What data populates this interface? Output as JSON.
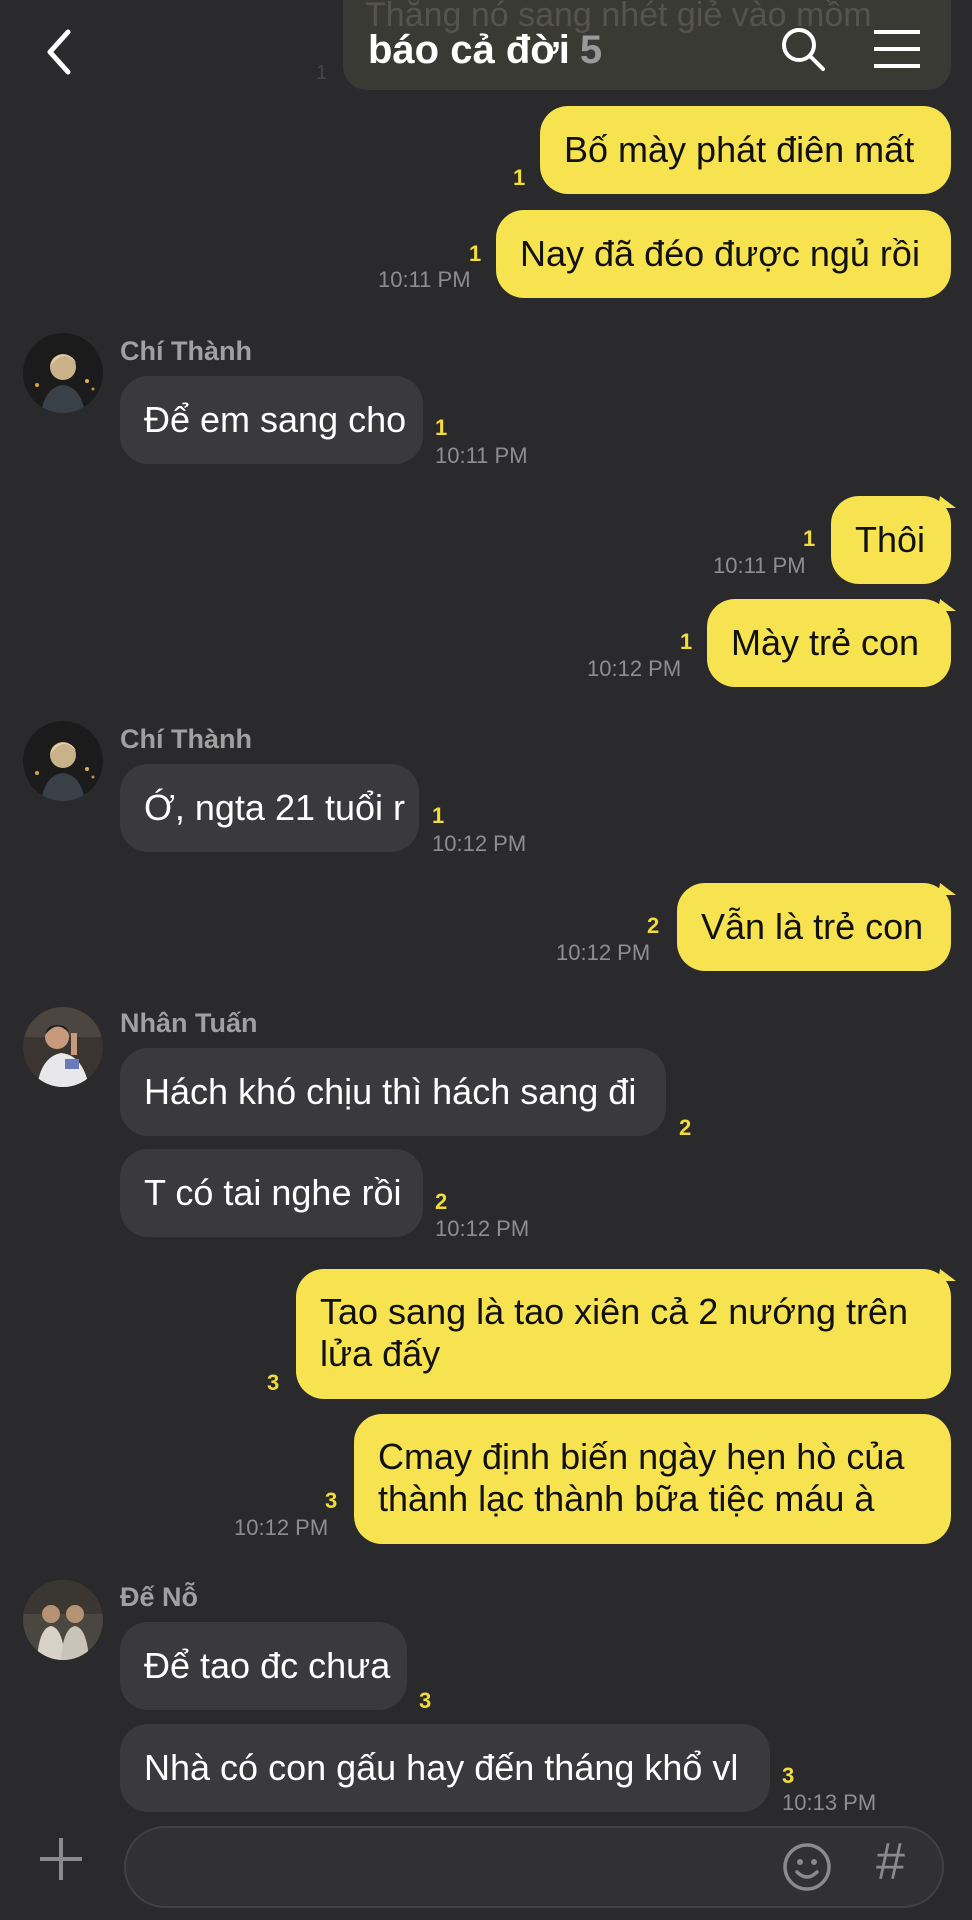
{
  "header": {
    "title": "báo cả đời",
    "member_count": "5",
    "back_icon": "chevron-left-icon",
    "search_icon": "search-icon",
    "menu_icon": "hamburger-menu-icon"
  },
  "top_remnant": {
    "text": "Thằng nó sang nhét giẻ vào mồm",
    "read": "1"
  },
  "messages": [
    {
      "text": "Bố mày phát điên mất",
      "read": "1"
    },
    {
      "text": "Nay đã đéo được ngủ rồi",
      "read": "1",
      "time": "10:11 PM"
    },
    {
      "sender": "Chí Thành",
      "text": "Để em sang cho",
      "read": "1",
      "time": "10:11 PM"
    },
    {
      "text": "Thôi",
      "read": "1",
      "time": "10:11 PM"
    },
    {
      "text": "Mày trẻ con",
      "read": "1",
      "time": "10:12 PM"
    },
    {
      "sender": "Chí Thành",
      "text": "Ớ, ngta 21 tuổi r",
      "read": "1",
      "time": "10:12 PM"
    },
    {
      "text": "Vẫn là trẻ con",
      "read": "2",
      "time": "10:12 PM"
    },
    {
      "sender": "Nhân Tuấn",
      "text": "Hách khó chịu thì hách sang đi",
      "read": "2"
    },
    {
      "text": "T có tai nghe rồi",
      "read": "2",
      "time": "10:12 PM"
    },
    {
      "text": "Tao sang là tao xiên cả 2 nướng trên lửa đấy",
      "read": "3"
    },
    {
      "text": "Cmay định biến ngày hẹn hò của thành lạc thành bữa tiệc máu à",
      "read": "3",
      "time": "10:12 PM"
    },
    {
      "sender": "Đế Nỗ",
      "text": "Để tao đc chưa",
      "read": "3"
    },
    {
      "text": "Nhà có con gấu hay đến tháng khổ vl",
      "read": "3",
      "time": "10:13 PM"
    }
  ],
  "input": {
    "placeholder": "",
    "plus_icon": "plus-icon",
    "emoji_icon": "emoji-icon",
    "hash_label": "#"
  },
  "colors": {
    "background": "#2a2a2c",
    "outgoing_bubble": "#f7e34f",
    "incoming_bubble": "#3a3a3c",
    "read_count": "#f2dc3c"
  }
}
